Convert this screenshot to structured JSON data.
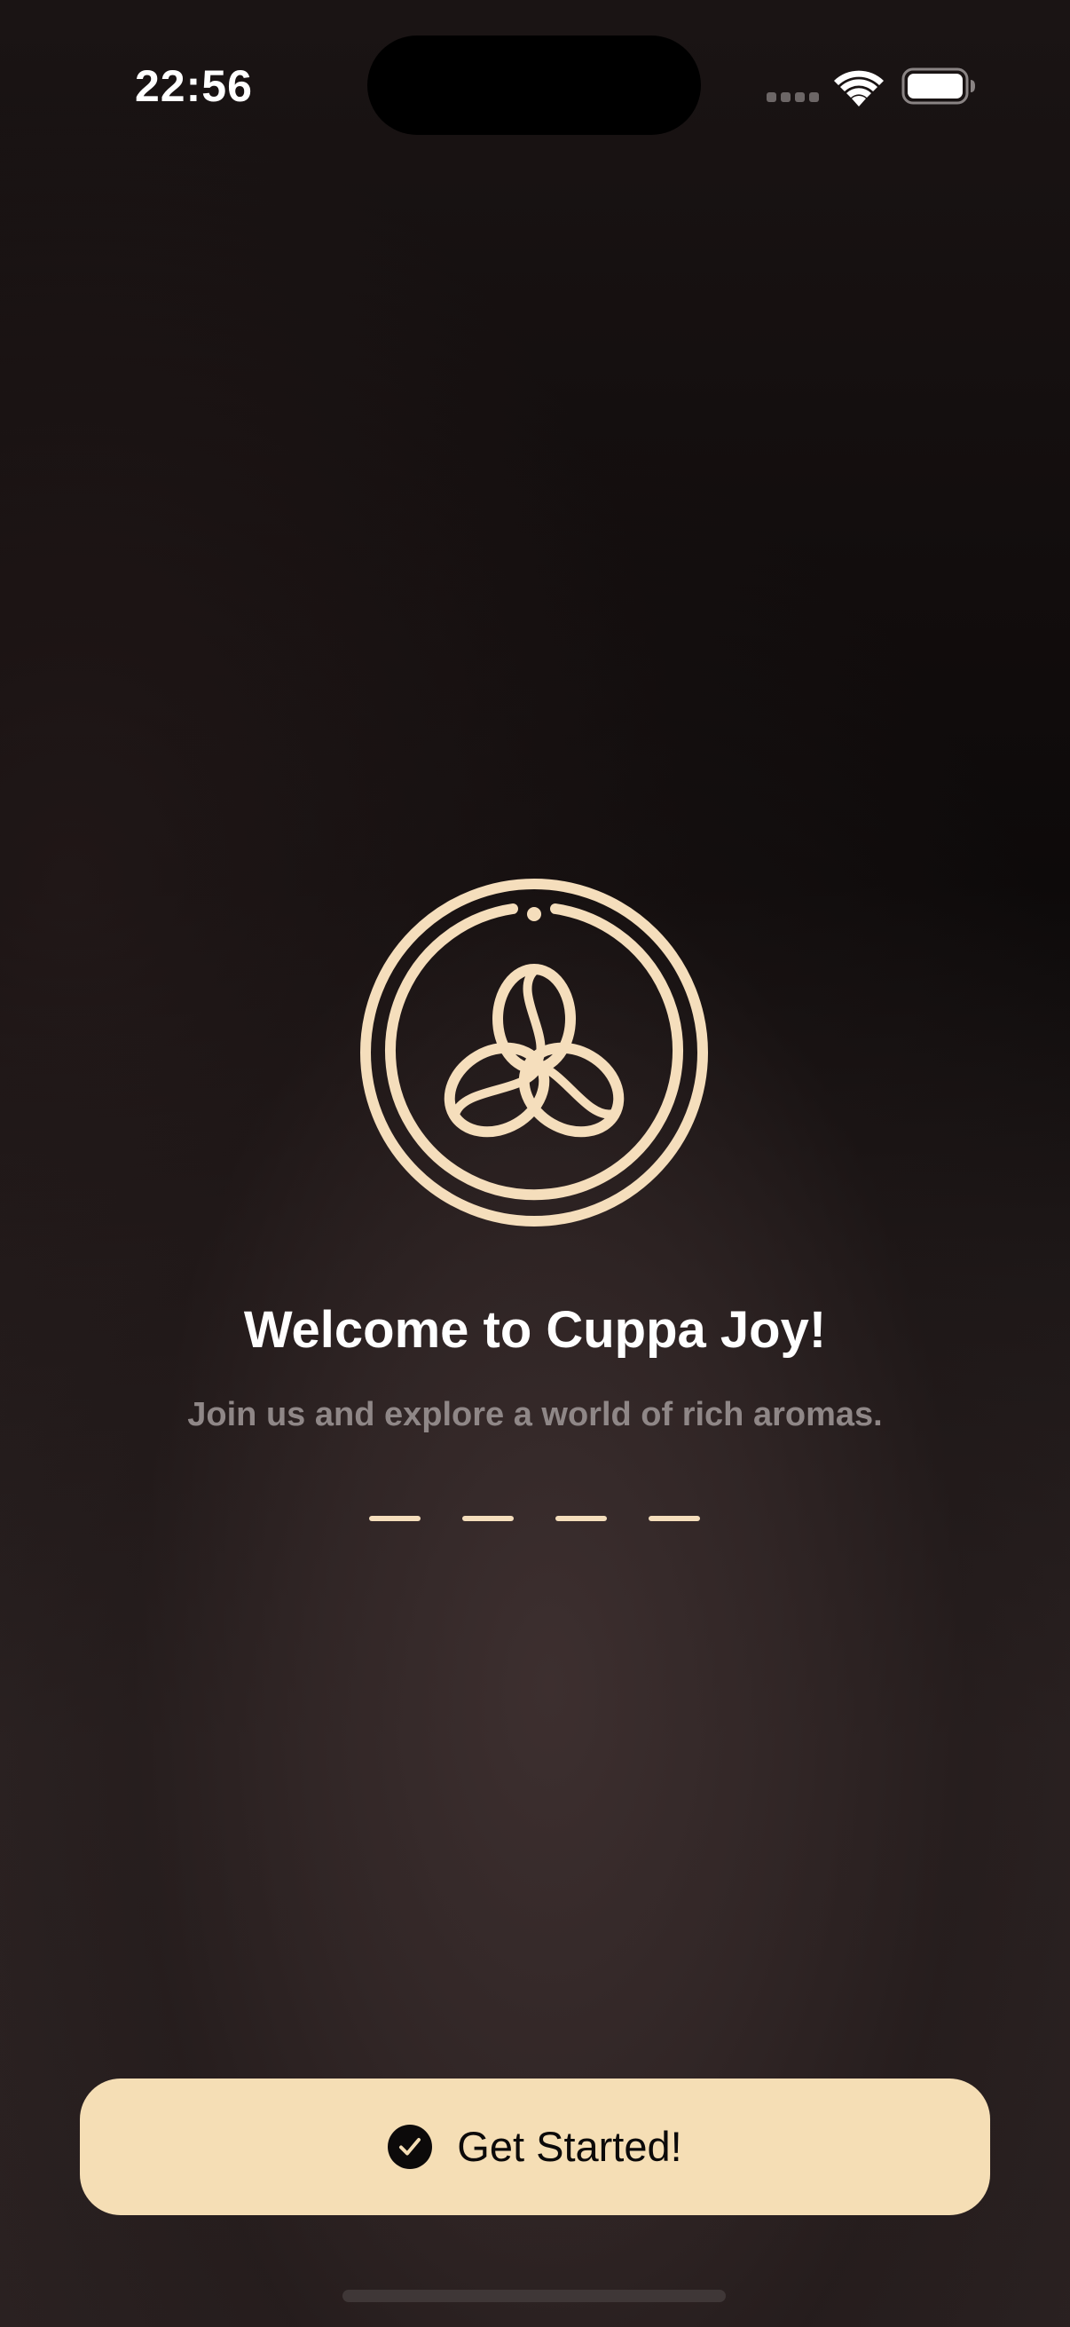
{
  "status_bar": {
    "time": "22:56",
    "icons": [
      "cellular-signal-icon",
      "wifi-icon",
      "battery-icon"
    ]
  },
  "welcome": {
    "logo_icon": "coffee-beans-logo",
    "title": "Welcome to Cuppa Joy!",
    "subtitle": "Join us and explore a world of rich aromas.",
    "page_count": 4
  },
  "actions": {
    "get_started_label": "Get Started!",
    "get_started_icon": "checkmark-circle-icon"
  },
  "colors": {
    "accent": "#F5DEB5",
    "logo": "#F5DEBC",
    "title": "#FFFFFF",
    "subtitle": "#8F8787",
    "background_dark": "#0B0808",
    "background_warm": "#3A2F2F"
  }
}
